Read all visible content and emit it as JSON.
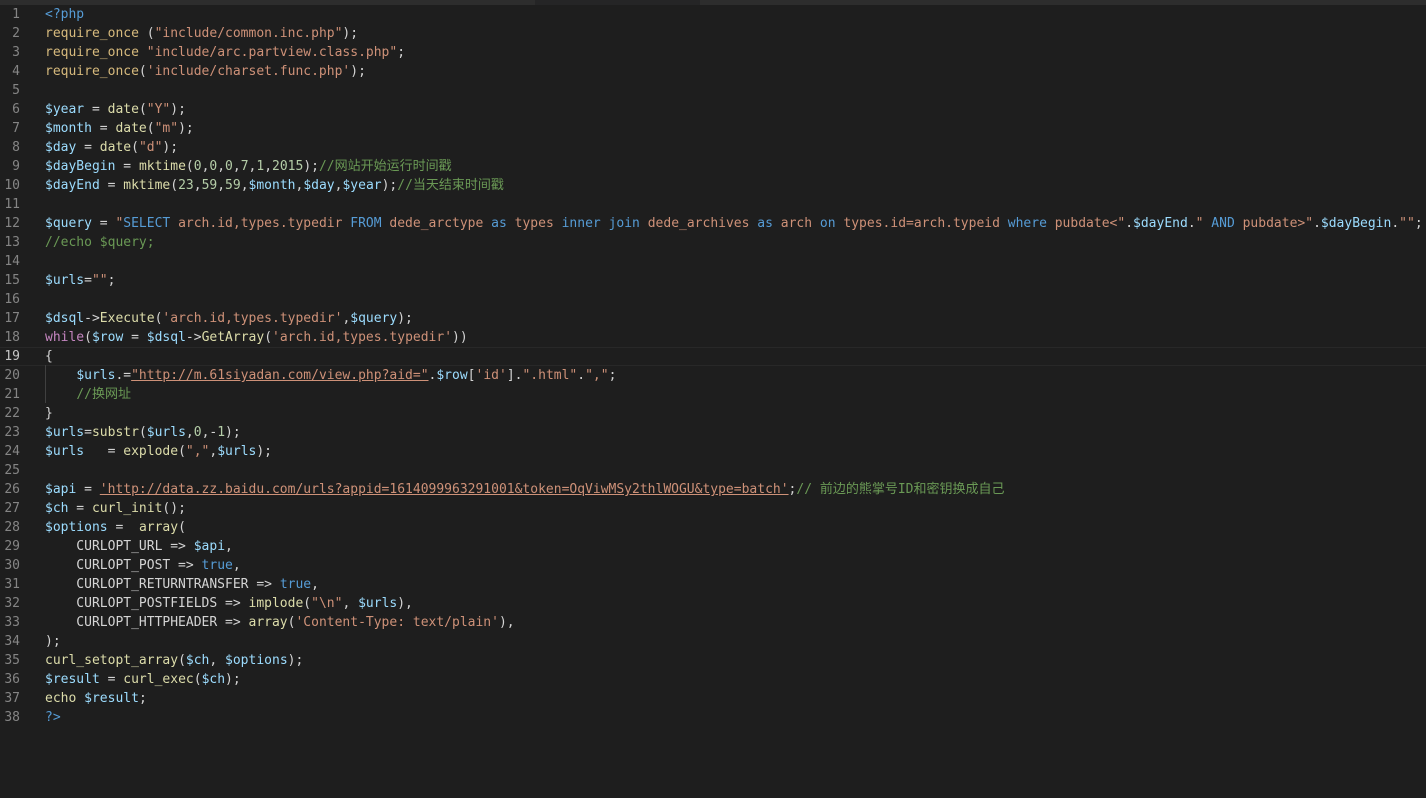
{
  "editor": {
    "lines": [
      [
        [
          "kw",
          "<?php"
        ]
      ],
      [
        [
          "inc",
          "require_once"
        ],
        [
          "punc",
          " ("
        ],
        [
          "str",
          "\"include/common.inc.php\""
        ],
        [
          "punc",
          ");"
        ]
      ],
      [
        [
          "inc",
          "require_once"
        ],
        [
          "punc",
          " "
        ],
        [
          "str",
          "\"include/arc.partview.class.php\""
        ],
        [
          "punc",
          ";"
        ]
      ],
      [
        [
          "inc",
          "require_once"
        ],
        [
          "punc",
          "("
        ],
        [
          "str",
          "'include/charset.func.php'"
        ],
        [
          "punc",
          ");"
        ]
      ],
      [],
      [
        [
          "var",
          "$year"
        ],
        [
          "punc",
          " = "
        ],
        [
          "fn",
          "date"
        ],
        [
          "punc",
          "("
        ],
        [
          "str",
          "\"Y\""
        ],
        [
          "punc",
          ");"
        ]
      ],
      [
        [
          "var",
          "$month"
        ],
        [
          "punc",
          " = "
        ],
        [
          "fn",
          "date"
        ],
        [
          "punc",
          "("
        ],
        [
          "str",
          "\"m\""
        ],
        [
          "punc",
          ");"
        ]
      ],
      [
        [
          "var",
          "$day"
        ],
        [
          "punc",
          " = "
        ],
        [
          "fn",
          "date"
        ],
        [
          "punc",
          "("
        ],
        [
          "str",
          "\"d\""
        ],
        [
          "punc",
          ");"
        ]
      ],
      [
        [
          "var",
          "$dayBegin"
        ],
        [
          "punc",
          " = "
        ],
        [
          "fn",
          "mktime"
        ],
        [
          "punc",
          "("
        ],
        [
          "num",
          "0"
        ],
        [
          "punc",
          ","
        ],
        [
          "num",
          "0"
        ],
        [
          "punc",
          ","
        ],
        [
          "num",
          "0"
        ],
        [
          "punc",
          ","
        ],
        [
          "num",
          "7"
        ],
        [
          "punc",
          ","
        ],
        [
          "num",
          "1"
        ],
        [
          "punc",
          ","
        ],
        [
          "num",
          "2015"
        ],
        [
          "punc",
          ");"
        ],
        [
          "cm",
          "//网站开始运行时间戳"
        ]
      ],
      [
        [
          "var",
          "$dayEnd"
        ],
        [
          "punc",
          " = "
        ],
        [
          "fn",
          "mktime"
        ],
        [
          "punc",
          "("
        ],
        [
          "num",
          "23"
        ],
        [
          "punc",
          ","
        ],
        [
          "num",
          "59"
        ],
        [
          "punc",
          ","
        ],
        [
          "num",
          "59"
        ],
        [
          "punc",
          ","
        ],
        [
          "var",
          "$month"
        ],
        [
          "punc",
          ","
        ],
        [
          "var",
          "$day"
        ],
        [
          "punc",
          ","
        ],
        [
          "var",
          "$year"
        ],
        [
          "punc",
          ");"
        ],
        [
          "cm",
          "//当天结束时间戳"
        ]
      ],
      [],
      [
        [
          "var",
          "$query"
        ],
        [
          "punc",
          " = "
        ],
        [
          "str",
          "\""
        ],
        [
          "kw",
          "SELECT"
        ],
        [
          "str",
          " arch.id,types.typedir "
        ],
        [
          "kw",
          "FROM"
        ],
        [
          "str",
          " dede_arctype "
        ],
        [
          "kw",
          "as"
        ],
        [
          "str",
          " types "
        ],
        [
          "kw",
          "inner join"
        ],
        [
          "str",
          " dede_archives "
        ],
        [
          "kw",
          "as"
        ],
        [
          "str",
          " arch "
        ],
        [
          "kw",
          "on"
        ],
        [
          "str",
          " types.id=arch.typeid "
        ],
        [
          "kw",
          "where"
        ],
        [
          "str",
          " pubdate<\""
        ],
        [
          "punc",
          "."
        ],
        [
          "var",
          "$dayEnd"
        ],
        [
          "punc",
          "."
        ],
        [
          "str",
          "\" "
        ],
        [
          "kw",
          "AND"
        ],
        [
          "str",
          " pubdate>\""
        ],
        [
          "punc",
          "."
        ],
        [
          "var",
          "$dayBegin"
        ],
        [
          "punc",
          "."
        ],
        [
          "str",
          "\"\""
        ],
        [
          "punc",
          ";"
        ]
      ],
      [
        [
          "cm",
          "//echo $query;"
        ]
      ],
      [],
      [
        [
          "var",
          "$urls"
        ],
        [
          "punc",
          "="
        ],
        [
          "str",
          "\"\""
        ],
        [
          "punc",
          ";"
        ]
      ],
      [],
      [
        [
          "var",
          "$dsql"
        ],
        [
          "punc",
          "->"
        ],
        [
          "fn",
          "Execute"
        ],
        [
          "punc",
          "("
        ],
        [
          "str",
          "'arch.id,types.typedir'"
        ],
        [
          "punc",
          ","
        ],
        [
          "var",
          "$query"
        ],
        [
          "punc",
          ");"
        ]
      ],
      [
        [
          "ctrl",
          "while"
        ],
        [
          "punc",
          "("
        ],
        [
          "var",
          "$row"
        ],
        [
          "punc",
          " = "
        ],
        [
          "var",
          "$dsql"
        ],
        [
          "punc",
          "->"
        ],
        [
          "fn",
          "GetArray"
        ],
        [
          "punc",
          "("
        ],
        [
          "str",
          "'arch.id,types.typedir'"
        ],
        [
          "punc",
          "))"
        ]
      ],
      [
        [
          "punc",
          "{"
        ]
      ],
      [
        [
          "punc",
          "    "
        ],
        [
          "var",
          "$urls"
        ],
        [
          "punc",
          ".="
        ],
        [
          "str url",
          "\"http://m.61siyadan.com/view.php?aid=\""
        ],
        [
          "punc",
          "."
        ],
        [
          "var",
          "$row"
        ],
        [
          "punc",
          "["
        ],
        [
          "str",
          "'id'"
        ],
        [
          "punc",
          "]."
        ],
        [
          "str",
          "\".html\""
        ],
        [
          "punc",
          "."
        ],
        [
          "str",
          "\",\""
        ],
        [
          "punc",
          ";"
        ]
      ],
      [
        [
          "punc",
          "    "
        ],
        [
          "cm",
          "//换网址"
        ]
      ],
      [
        [
          "punc",
          "}"
        ]
      ],
      [
        [
          "var",
          "$urls"
        ],
        [
          "punc",
          "="
        ],
        [
          "fn",
          "substr"
        ],
        [
          "punc",
          "("
        ],
        [
          "var",
          "$urls"
        ],
        [
          "punc",
          ","
        ],
        [
          "num",
          "0"
        ],
        [
          "punc",
          ",-"
        ],
        [
          "num",
          "1"
        ],
        [
          "punc",
          ");"
        ]
      ],
      [
        [
          "var",
          "$urls"
        ],
        [
          "punc",
          "   = "
        ],
        [
          "fn",
          "explode"
        ],
        [
          "punc",
          "("
        ],
        [
          "str",
          "\",\""
        ],
        [
          "punc",
          ","
        ],
        [
          "var",
          "$urls"
        ],
        [
          "punc",
          ");"
        ]
      ],
      [],
      [
        [
          "var",
          "$api"
        ],
        [
          "punc",
          " = "
        ],
        [
          "str url",
          "'http://data.zz.baidu.com/urls?appid=1614099963291001&token=OqViwMSy2thlWOGU&type=batch'"
        ],
        [
          "punc",
          ";"
        ],
        [
          "cm",
          "// 前边的熊掌号ID和密钥换成自己"
        ]
      ],
      [
        [
          "var",
          "$ch"
        ],
        [
          "punc",
          " = "
        ],
        [
          "fn",
          "curl_init"
        ],
        [
          "punc",
          "();"
        ]
      ],
      [
        [
          "var",
          "$options"
        ],
        [
          "punc",
          " =  "
        ],
        [
          "fn",
          "array"
        ],
        [
          "punc",
          "("
        ]
      ],
      [
        [
          "punc",
          "    CURLOPT_URL => "
        ],
        [
          "var",
          "$api"
        ],
        [
          "punc",
          ","
        ]
      ],
      [
        [
          "punc",
          "    CURLOPT_POST => "
        ],
        [
          "kw",
          "true"
        ],
        [
          "punc",
          ","
        ]
      ],
      [
        [
          "punc",
          "    CURLOPT_RETURNTRANSFER => "
        ],
        [
          "kw",
          "true"
        ],
        [
          "punc",
          ","
        ]
      ],
      [
        [
          "punc",
          "    CURLOPT_POSTFIELDS => "
        ],
        [
          "fn",
          "implode"
        ],
        [
          "punc",
          "("
        ],
        [
          "str",
          "\"\\n\""
        ],
        [
          "punc",
          ", "
        ],
        [
          "var",
          "$urls"
        ],
        [
          "punc",
          "),"
        ]
      ],
      [
        [
          "punc",
          "    CURLOPT_HTTPHEADER => "
        ],
        [
          "fn",
          "array"
        ],
        [
          "punc",
          "("
        ],
        [
          "str",
          "'Content-Type: text/plain'"
        ],
        [
          "punc",
          "),"
        ]
      ],
      [
        [
          "punc",
          ");"
        ]
      ],
      [
        [
          "fn",
          "curl_setopt_array"
        ],
        [
          "punc",
          "("
        ],
        [
          "var",
          "$ch"
        ],
        [
          "punc",
          ", "
        ],
        [
          "var",
          "$options"
        ],
        [
          "punc",
          ");"
        ]
      ],
      [
        [
          "var",
          "$result"
        ],
        [
          "punc",
          " = "
        ],
        [
          "fn",
          "curl_exec"
        ],
        [
          "punc",
          "("
        ],
        [
          "var",
          "$ch"
        ],
        [
          "punc",
          ");"
        ]
      ],
      [
        [
          "fn",
          "echo"
        ],
        [
          "punc",
          " "
        ],
        [
          "var",
          "$result"
        ],
        [
          "punc",
          ";"
        ]
      ],
      [
        [
          "kw",
          "?>"
        ]
      ]
    ],
    "current_line": 19
  }
}
